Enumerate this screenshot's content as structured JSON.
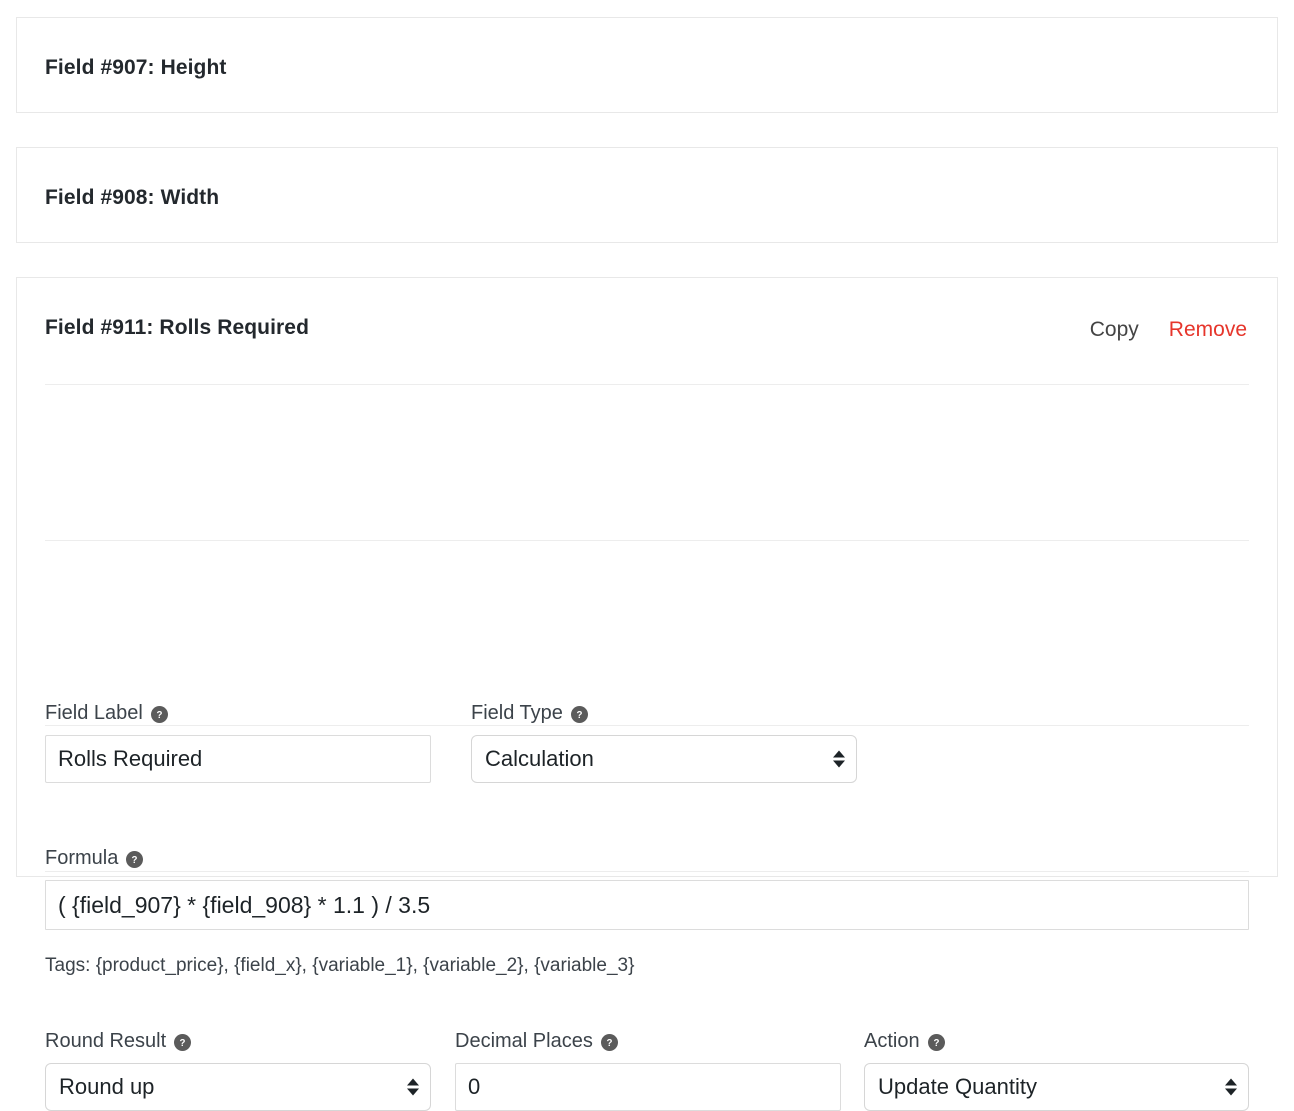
{
  "theme": {
    "page_background": "#ffffff",
    "card_background": "#ffffff",
    "card_border": "#e8e8e8",
    "divider": "#ededed",
    "text_primary": "#23282d",
    "text_secondary": "#3c434a",
    "link_copy": "#444444",
    "link_remove": "#e6352b",
    "help_icon_background": "#5b5b5b",
    "input_border": "#dcdcdc"
  },
  "cards": [
    {
      "title": "Field #907: Height",
      "state": "collapsed"
    },
    {
      "title": "Field #908: Width",
      "state": "collapsed"
    }
  ],
  "open_card": {
    "title": "Field #911: Rolls Required",
    "actions": {
      "copy_label": "Copy",
      "remove_label": "Remove"
    },
    "help_icon_glyph": "?",
    "fields": {
      "field_label": {
        "label": "Field Label",
        "value": "Rolls Required",
        "placeholder": "Field Label"
      },
      "field_type": {
        "label": "Field Type",
        "value": "Calculation"
      },
      "formula": {
        "label": "Formula",
        "value": "( {field_907} * {field_908} * 1.1 ) / 3.5",
        "placeholder": "Formula",
        "tags_text": "Tags: {product_price}, {field_x}, {variable_1}, {variable_2}, {variable_3}"
      },
      "round_result": {
        "label": "Round Result",
        "value": "Round up"
      },
      "decimal_places": {
        "label": "Decimal Places",
        "value": "0",
        "placeholder": "0"
      },
      "action": {
        "label": "Action",
        "value": "Update Quantity"
      }
    }
  }
}
